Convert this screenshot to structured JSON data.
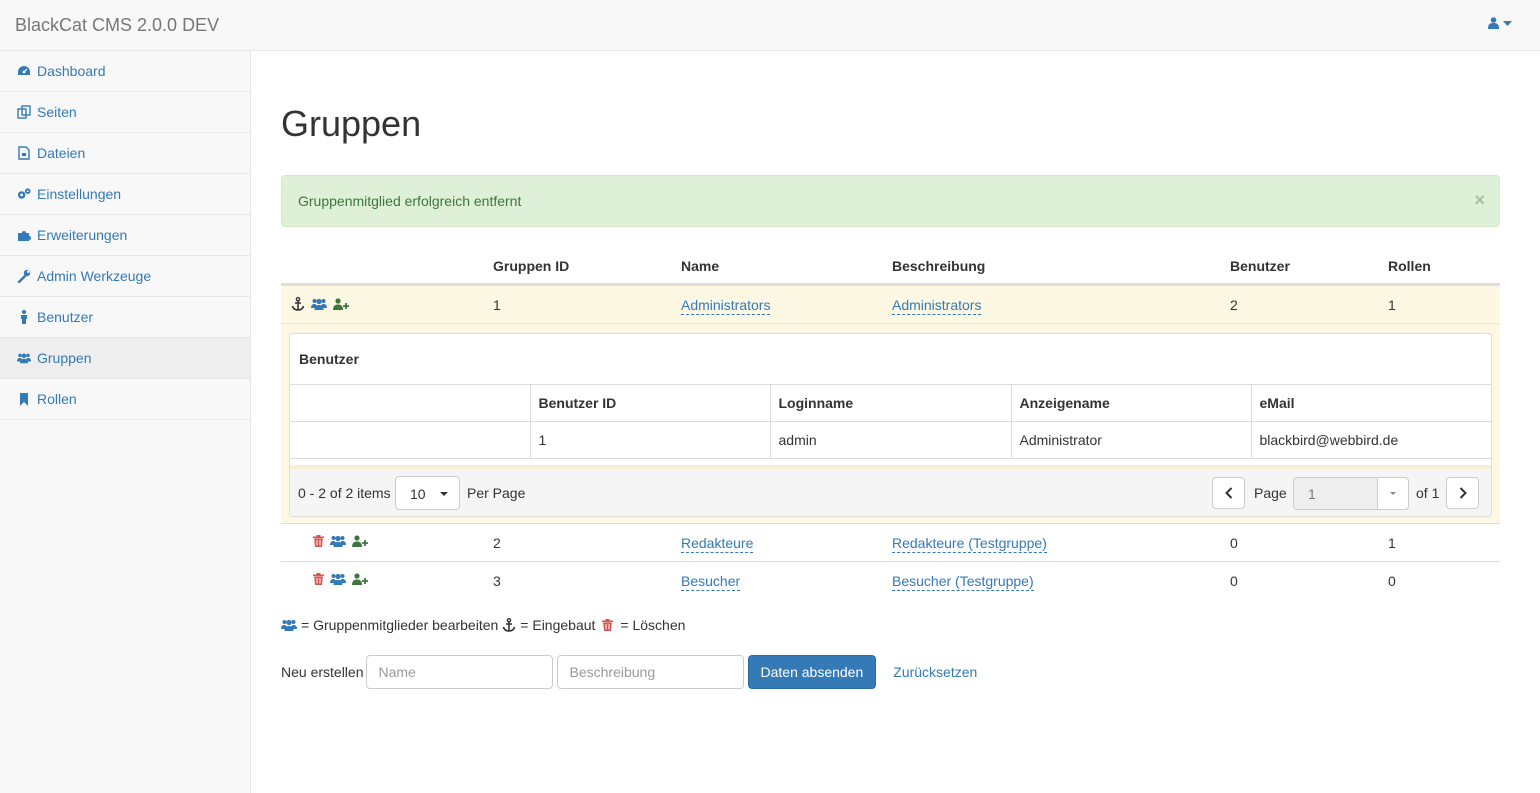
{
  "app": {
    "title": "BlackCat CMS 2.0.0 DEV"
  },
  "colors": {
    "primary": "#337ab7",
    "success_bg": "#dff0d8",
    "success_text": "#3c763d",
    "warning_bg": "#fcf8e3",
    "danger": "#d9534f",
    "add_green": "#3c763d"
  },
  "sidebar": {
    "items": [
      {
        "label": "Dashboard",
        "icon": "dashboard-icon"
      },
      {
        "label": "Seiten",
        "icon": "pages-icon"
      },
      {
        "label": "Dateien",
        "icon": "file-icon"
      },
      {
        "label": "Einstellungen",
        "icon": "gears-icon"
      },
      {
        "label": "Erweiterungen",
        "icon": "puzzle-icon"
      },
      {
        "label": "Admin Werkzeuge",
        "icon": "wrench-icon"
      },
      {
        "label": "Benutzer",
        "icon": "user-icon"
      },
      {
        "label": "Gruppen",
        "icon": "users-icon",
        "active": true
      },
      {
        "label": "Rollen",
        "icon": "bookmark-icon"
      }
    ]
  },
  "page": {
    "title": "Gruppen",
    "alert": "Gruppenmitglied erfolgreich entfernt",
    "alert_close": "×"
  },
  "groups": {
    "headers": {
      "id": "Gruppen ID",
      "name": "Name",
      "desc": "Beschreibung",
      "users": "Benutzer",
      "roles": "Rollen"
    },
    "rows": [
      {
        "id": "1",
        "name": "Administrators",
        "desc": "Administrators",
        "users": "2",
        "roles": "1"
      },
      {
        "id": "2",
        "name": "Redakteure",
        "desc": "Redakteure (Testgruppe)",
        "users": "0",
        "roles": "1"
      },
      {
        "id": "3",
        "name": "Besucher",
        "desc": "Besucher (Testgruppe)",
        "users": "0",
        "roles": "0"
      }
    ]
  },
  "members": {
    "title": "Benutzer",
    "headers": {
      "id": "Benutzer ID",
      "login": "Loginname",
      "display": "Anzeigename",
      "email": "eMail"
    },
    "rows": [
      {
        "id": "1",
        "login": "admin",
        "display": "Administrator",
        "email": "blackbird@webbird.de"
      }
    ],
    "pager": {
      "info": "0 - 2 of 2 items",
      "per_page_value": "10",
      "per_page_label": "Per Page",
      "page_label": "Page",
      "page_value": "1",
      "of_label": "of 1"
    }
  },
  "legend": {
    "members": "= Gruppenmitglieder bearbeiten",
    "builtin": "= Eingebaut",
    "delete": "= Löschen"
  },
  "form": {
    "label": "Neu erstellen",
    "name_placeholder": "Name",
    "desc_placeholder": "Beschreibung",
    "submit": "Daten absenden",
    "reset": "Zurücksetzen"
  }
}
